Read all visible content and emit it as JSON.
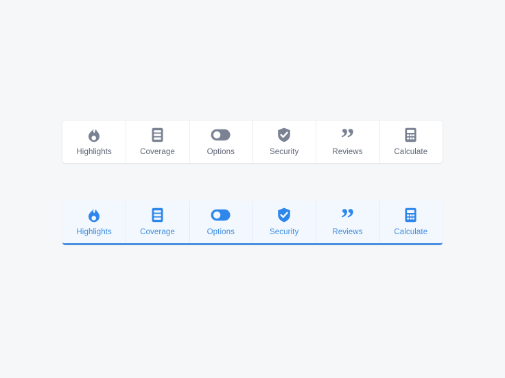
{
  "page": {
    "background_color": "#f6f7f8",
    "title": "Tab bar icon set"
  },
  "colors": {
    "default_icon": "#7a8293",
    "default_label": "#5d6575",
    "active_icon": "#2f87eb",
    "active_label": "#3d8ce0",
    "active_bar_background": "#f2f8fe",
    "active_underline": "#4a90e2",
    "card_background": "#ffffff",
    "divider": "#ecedef"
  },
  "tabbars": [
    {
      "state": "default",
      "name": "tabbar-default",
      "tabs": [
        {
          "label": "Highlights",
          "icon": "flame-icon"
        },
        {
          "label": "Coverage",
          "icon": "list-document-icon"
        },
        {
          "label": "Options",
          "icon": "toggle-switch-icon"
        },
        {
          "label": "Security",
          "icon": "shield-check-icon"
        },
        {
          "label": "Reviews",
          "icon": "quote-icon"
        },
        {
          "label": "Calculate",
          "icon": "calculator-icon"
        }
      ]
    },
    {
      "state": "active",
      "name": "tabbar-active",
      "tabs": [
        {
          "label": "Highlights",
          "icon": "flame-icon"
        },
        {
          "label": "Coverage",
          "icon": "list-document-icon"
        },
        {
          "label": "Options",
          "icon": "toggle-switch-icon"
        },
        {
          "label": "Security",
          "icon": "shield-check-icon"
        },
        {
          "label": "Reviews",
          "icon": "quote-icon"
        },
        {
          "label": "Calculate",
          "icon": "calculator-icon"
        }
      ]
    }
  ],
  "glyphs": {
    "quote": "”"
  }
}
